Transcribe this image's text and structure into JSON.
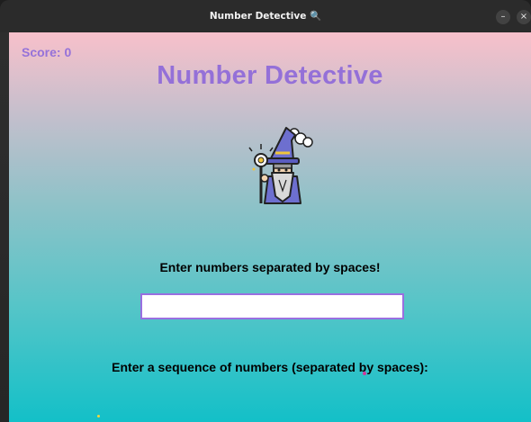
{
  "window": {
    "title": "Number Detective 🔍",
    "minimize_label": "–",
    "close_label": "×"
  },
  "game": {
    "score": "Score: 0",
    "title": "Number Detective",
    "mascot_icon": "wizard-icon",
    "instruction": "Enter numbers separated by spaces!",
    "input_value": "",
    "prompt": "Enter a sequence of numbers (separated by spaces):"
  },
  "colors": {
    "title_color": "#9470d8",
    "input_border": "#9a6fe0",
    "gradient_top": "#f8c0cb",
    "gradient_bottom": "#13c0c8",
    "titlebar": "#2b2b2b"
  }
}
